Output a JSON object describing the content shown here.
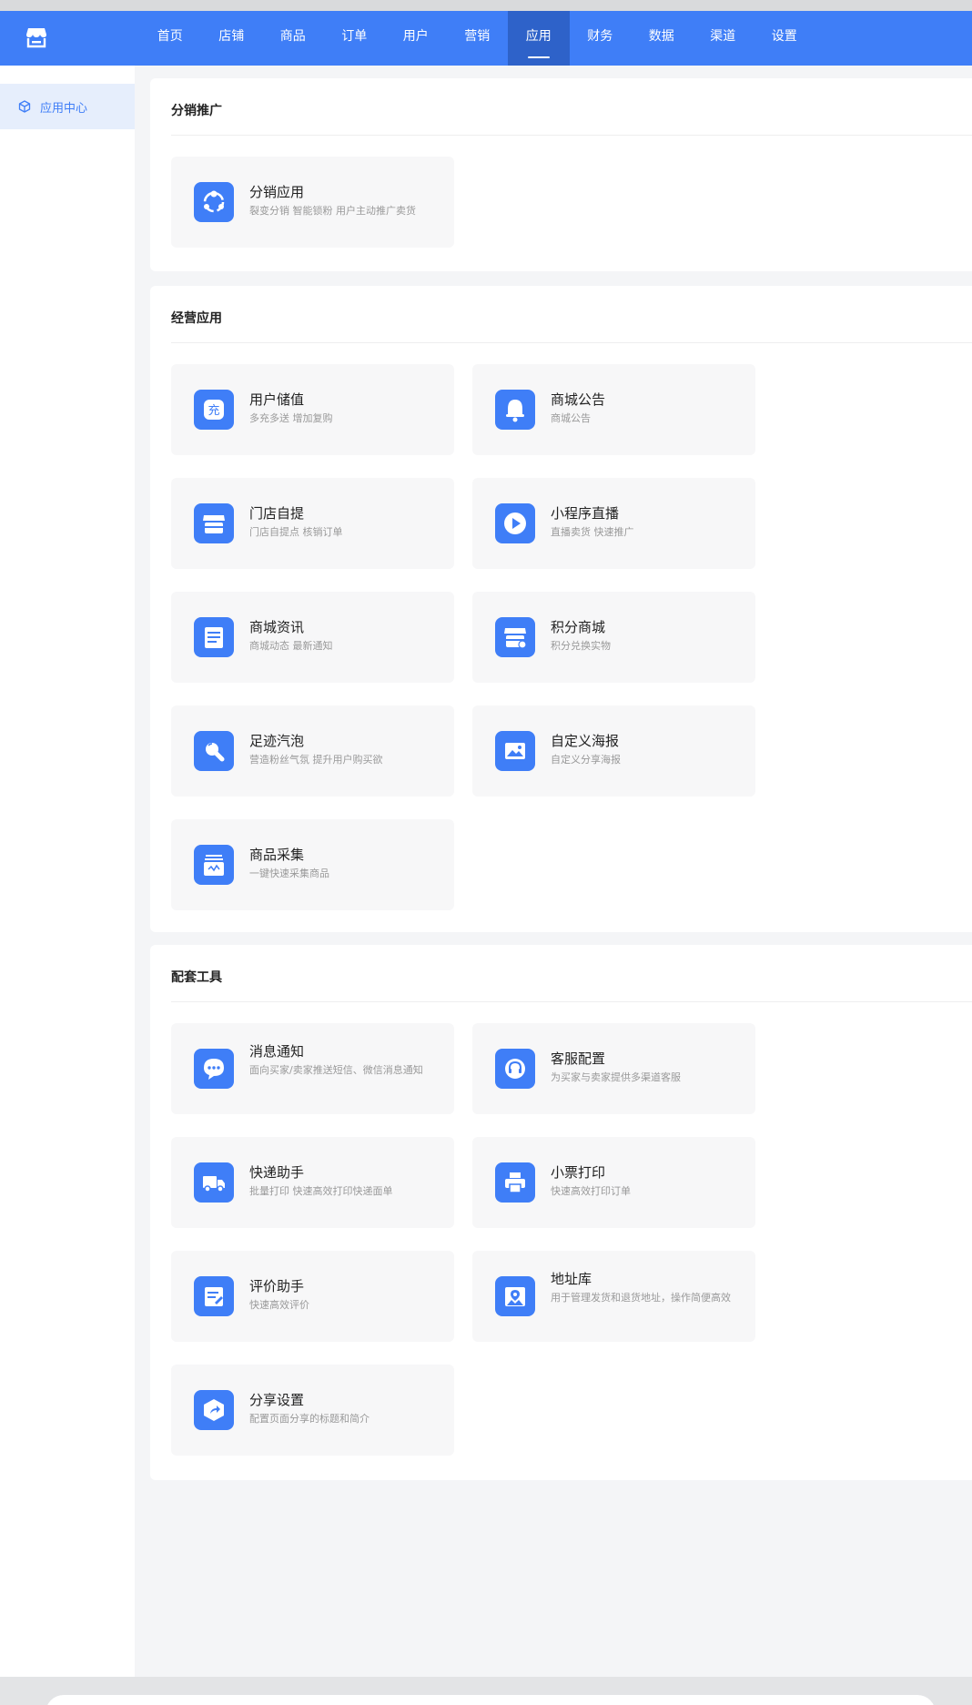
{
  "nav": {
    "items": [
      "首页",
      "店铺",
      "商品",
      "订单",
      "用户",
      "营销",
      "应用",
      "财务",
      "数据",
      "渠道",
      "设置"
    ],
    "active_index": 6
  },
  "sidebar": {
    "items": [
      {
        "label": "应用中心",
        "icon": "cube-icon"
      }
    ]
  },
  "sections": [
    {
      "title": "分销推广",
      "apps": [
        {
          "name": "分销应用",
          "desc": "裂变分销 智能锁粉 用户主动推广卖货",
          "icon": "distribution-icon"
        }
      ]
    },
    {
      "title": "经营应用",
      "apps": [
        {
          "name": "用户储值",
          "desc": "多充多送 增加复购",
          "icon": "recharge-icon"
        },
        {
          "name": "商城公告",
          "desc": "商城公告",
          "icon": "bell-icon"
        },
        {
          "name": "门店自提",
          "desc": "门店自提点 核销订单",
          "icon": "store-icon"
        },
        {
          "name": "小程序直播",
          "desc": "直播卖货 快速推广",
          "icon": "play-icon"
        },
        {
          "name": "商城资讯",
          "desc": "商城动态 最新通知",
          "icon": "news-icon"
        },
        {
          "name": "积分商城",
          "desc": "积分兑换实物",
          "icon": "points-store-icon"
        },
        {
          "name": "足迹汽泡",
          "desc": "营造粉丝气氛 提升用户购买欲",
          "icon": "bubble-icon"
        },
        {
          "name": "自定义海报",
          "desc": "自定义分享海报",
          "icon": "image-icon"
        },
        {
          "name": "商品采集",
          "desc": "一键快速采集商品",
          "icon": "collect-icon"
        }
      ]
    },
    {
      "title": "配套工具",
      "apps": [
        {
          "name": "消息通知",
          "desc": "面向买家/卖家推送短信、微信消息通知",
          "icon": "message-icon"
        },
        {
          "name": "客服配置",
          "desc": "为买家与卖家提供多渠道客服",
          "icon": "headset-icon"
        },
        {
          "name": "快递助手",
          "desc": "批量打印 快速高效打印快递面单",
          "icon": "truck-icon"
        },
        {
          "name": "小票打印",
          "desc": "快速高效打印订单",
          "icon": "printer-icon"
        },
        {
          "name": "评价助手",
          "desc": "快速高效评价",
          "icon": "review-icon"
        },
        {
          "name": "地址库",
          "desc": "用于管理发货和退货地址，操作简便高效",
          "icon": "address-icon"
        },
        {
          "name": "分享设置",
          "desc": "配置页面分享的标题和简介",
          "icon": "share-icon"
        }
      ]
    }
  ],
  "colors": {
    "accent": "#3f7ef7",
    "nav_active": "#2e62c9",
    "side_active_bg": "#e6eefc"
  }
}
